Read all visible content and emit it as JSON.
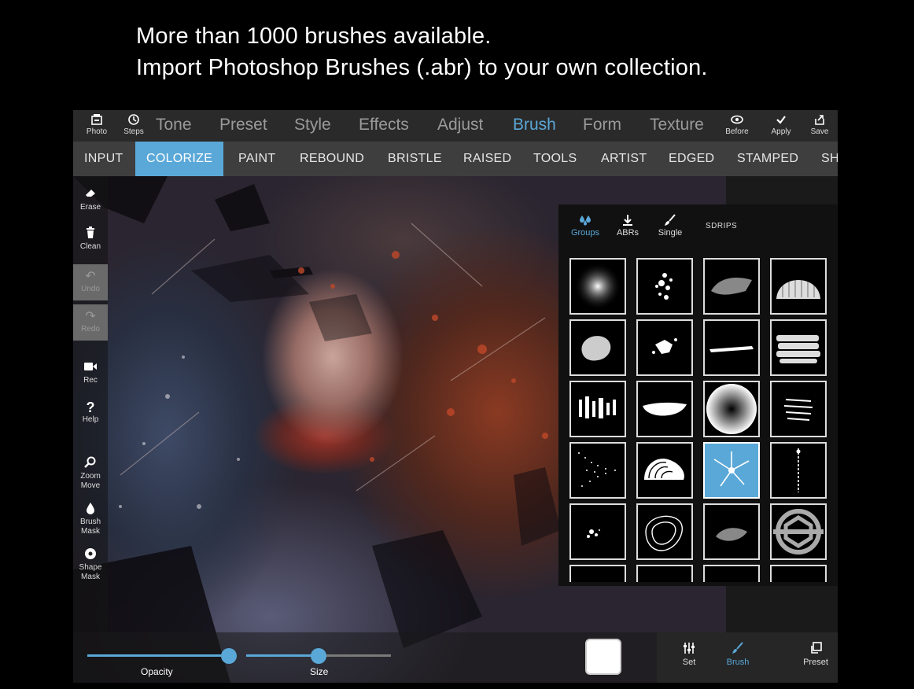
{
  "headline": {
    "line1": "More than 1000 brushes available.",
    "line2": "Import Photoshop Brushes (.abr) to your own collection."
  },
  "topbar": {
    "photo": {
      "label": "Photo",
      "icon": "photo-icon"
    },
    "steps": {
      "label": "Steps",
      "icon": "history-icon"
    },
    "tabs": [
      "Tone",
      "Preset",
      "Style",
      "Effects",
      "Adjust",
      "Brush",
      "Form",
      "Texture"
    ],
    "active_tab": "Brush",
    "before": {
      "label": "Before",
      "icon": "eye-icon"
    },
    "apply": {
      "label": "Apply",
      "icon": "check-icon"
    },
    "save": {
      "label": "Save",
      "icon": "share-icon"
    }
  },
  "subtabs": {
    "items": [
      "INPUT",
      "COLORIZE",
      "PAINT",
      "REBOUND",
      "BRISTLE",
      "RAISED",
      "TOOLS",
      "ARTIST",
      "EDGED",
      "STAMPED",
      "SH"
    ],
    "active": "COLORIZE"
  },
  "tools": [
    {
      "label": "Erase",
      "icon": "eraser-icon"
    },
    {
      "label": "Clean",
      "icon": "trash-icon"
    },
    {
      "label": "Undo",
      "icon": "undo-icon",
      "disabled": true
    },
    {
      "label": "Redo",
      "icon": "redo-icon",
      "disabled": true
    },
    {
      "label": "Rec",
      "icon": "video-icon"
    },
    {
      "label": "Help",
      "icon": "question-icon"
    },
    {
      "label": "Zoom",
      "label2": "Move",
      "icon": "magnifier-icon"
    },
    {
      "label": "Brush",
      "label2": "Mask",
      "icon": "drop-icon"
    },
    {
      "label": "Shape",
      "label2": "Mask",
      "icon": "circle-dot-icon"
    }
  ],
  "brush_panel": {
    "tabs": [
      {
        "label": "Groups",
        "icon": "drops-icon",
        "active": true
      },
      {
        "label": "ABRs",
        "icon": "download-icon",
        "active": false
      },
      {
        "label": "Single",
        "icon": "brush-icon",
        "active": false
      }
    ],
    "group_name": "SDRIPS"
  },
  "bottombar": {
    "opacity_label": "Opacity",
    "opacity_value": 0.9,
    "size_label": "Size",
    "size_value": 0.5,
    "color": "#ffffff",
    "set": {
      "label": "Set",
      "icon": "sliders-icon"
    },
    "brush": {
      "label": "Brush",
      "icon": "brush-icon"
    },
    "preset": {
      "label": "Preset",
      "icon": "copy-icon"
    }
  },
  "colors": {
    "accent": "#5aa8d8"
  }
}
